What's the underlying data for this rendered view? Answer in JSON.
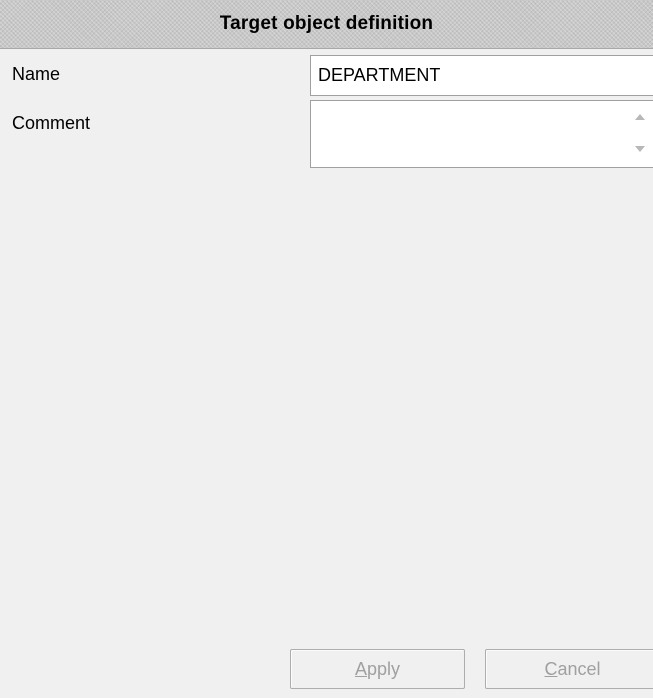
{
  "header": {
    "title": "Target object definition"
  },
  "form": {
    "name_label": "Name",
    "name_value": "DEPARTMENT",
    "comment_label": "Comment",
    "comment_value": ""
  },
  "buttons": {
    "apply": {
      "mnemonic": "A",
      "rest": "pply",
      "enabled": false
    },
    "cancel": {
      "mnemonic": "C",
      "rest": "ancel",
      "enabled": false
    }
  },
  "icons": {
    "scroll_up": "scroll-up-arrow-icon",
    "scroll_down": "scroll-down-arrow-icon"
  },
  "colors": {
    "header_background": "#c8c8c8",
    "panel_background": "#f0f0f0",
    "disabled_text": "#a0a0a0",
    "input_border": "#a0a0a0"
  }
}
